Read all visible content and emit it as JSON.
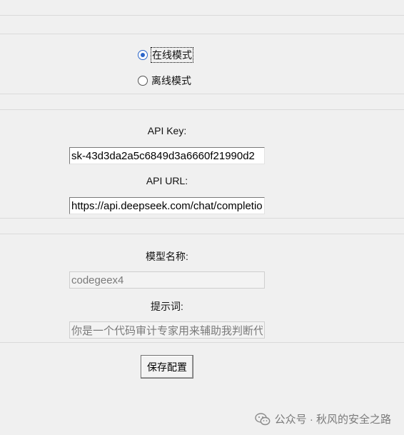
{
  "mode": {
    "online_label": "在线模式",
    "offline_label": "离线模式",
    "selected": "online"
  },
  "api": {
    "key_label": "API Key:",
    "key_value": "sk-43d3da2a5c6849d3a6660f21990d2",
    "url_label": "API URL:",
    "url_value": "https://api.deepseek.com/chat/completions"
  },
  "model": {
    "name_label": "模型名称:",
    "name_value": "codegeex4",
    "prompt_label": "提示词:",
    "prompt_value": "你是一个代码审计专家用来辅助我判断代码"
  },
  "actions": {
    "save_label": "保存配置"
  },
  "watermark": {
    "text": "公众号 · 秋风的安全之路",
    "icon": "wechat-icon"
  },
  "colors": {
    "accent": "#2a65c9",
    "background": "#f0f0f0"
  }
}
